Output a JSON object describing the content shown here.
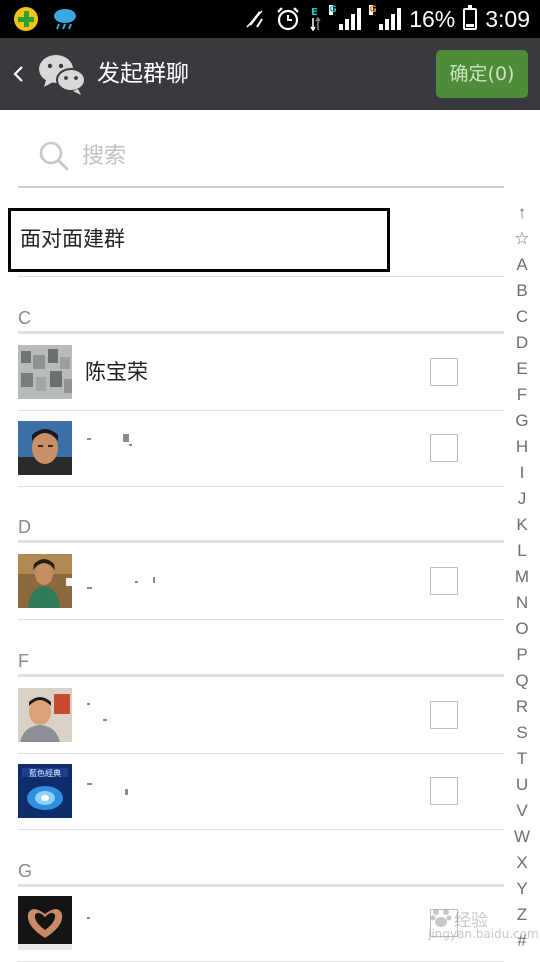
{
  "status_bar": {
    "left_icons": [
      "app-notification-icon",
      "weather-icon"
    ],
    "right_icons": [
      "vibrate-off-icon",
      "alarm-icon",
      "data-arrows-icon",
      "signal-icon",
      "signal-icon",
      "battery-icon"
    ],
    "network_labels": [
      "E",
      "G",
      "G"
    ],
    "battery_percent": "16%",
    "battery_level": 0.16,
    "time": "3:09"
  },
  "header": {
    "back_icon": "chevron-left-icon",
    "logo_icon": "wechat-logo-icon",
    "title": "发起群聊",
    "confirm_label": "确定(0)",
    "background_color": "#393a3f",
    "confirm_color": "#4f8c3a"
  },
  "search": {
    "placeholder": "搜索",
    "value": ""
  },
  "face_to_face": {
    "label": "面对面建群"
  },
  "sections": [
    {
      "letter": "C",
      "contacts": [
        {
          "name": "陈宝荣",
          "checked": false,
          "avatar": "photo"
        },
        {
          "name": "",
          "checked": false,
          "avatar": "photo"
        }
      ]
    },
    {
      "letter": "D",
      "contacts": [
        {
          "name": "",
          "checked": false,
          "avatar": "photo"
        }
      ]
    },
    {
      "letter": "F",
      "contacts": [
        {
          "name": "",
          "checked": false,
          "avatar": "photo"
        },
        {
          "name": "",
          "checked": false,
          "avatar": "photo"
        }
      ]
    },
    {
      "letter": "G",
      "contacts": [
        {
          "name": "",
          "checked": false,
          "avatar": "photo"
        }
      ]
    }
  ],
  "index_bar": [
    "↑",
    "☆",
    "A",
    "B",
    "C",
    "D",
    "E",
    "F",
    "G",
    "H",
    "I",
    "J",
    "K",
    "L",
    "M",
    "N",
    "O",
    "P",
    "Q",
    "R",
    "S",
    "T",
    "U",
    "V",
    "W",
    "X",
    "Y",
    "Z",
    "#"
  ],
  "watermark": {
    "text": "经验",
    "url": "jingyan.baidu.com"
  }
}
